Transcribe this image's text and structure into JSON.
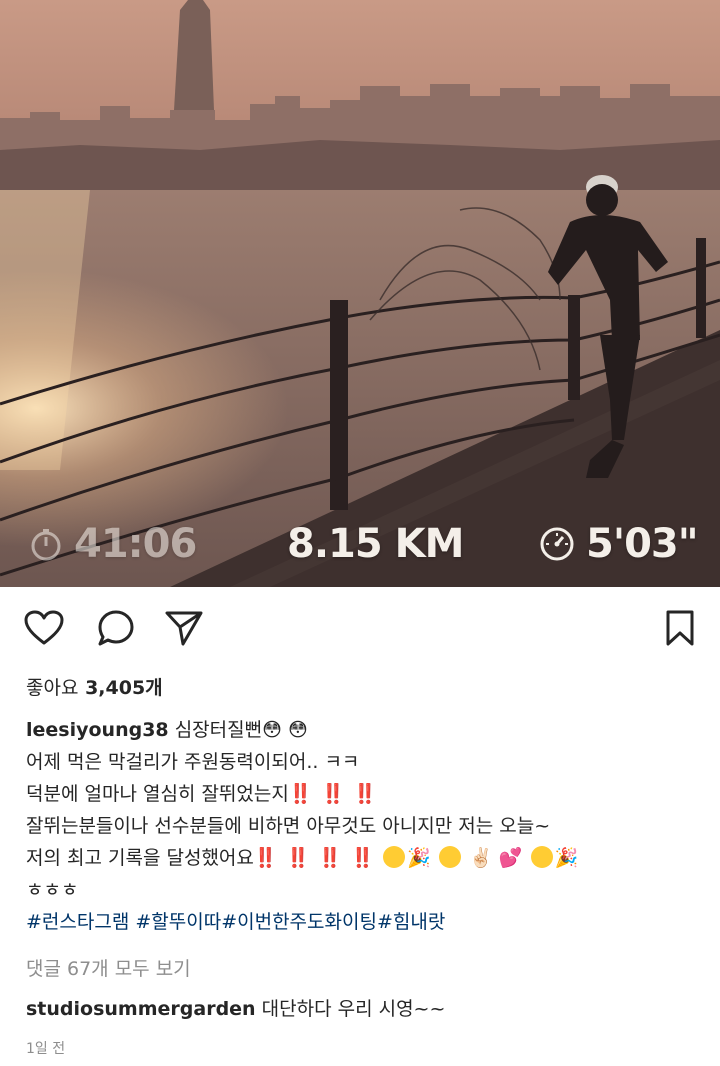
{
  "post": {
    "overlay_stats": {
      "time": "41:06",
      "distance": "8.15 KM",
      "pace": "5'03\"",
      "time_icon": "stopwatch-icon",
      "pace_icon": "speedometer-icon"
    },
    "actions": {
      "like_icon": "heart-icon",
      "comment_icon": "comment-icon",
      "share_icon": "send-icon",
      "save_icon": "bookmark-icon"
    },
    "likes": {
      "label": "좋아요",
      "count": "3,405개"
    },
    "caption": {
      "username": "leesiyoung38",
      "line1_text": "심장터질뻔",
      "line2": "어제 먹은 막걸리가 주원동력이되어.. ㅋㅋ",
      "line3_text": "덕분에 얼마나 열심히 잘뛰었는지",
      "line3_marks": "‼️ ‼️ ‼️",
      "line4": "잘뛰는분들이나 선수분들에 비하면 아무것도 아니지만 저는 오늘~",
      "line5_text": "저의 최고 기록을 달성했어요",
      "line5_marks": "‼️ ‼️ ‼️ ‼️",
      "line6": "ㅎㅎㅎ",
      "hashtags": "#런스타그램 #할뚜이따#이번한주도화이팅#힘내랏"
    },
    "view_comments": "댓글 67개 모두 보기",
    "comment": {
      "username": "studiosummergarden",
      "text": "대단하다 우리 시영~~"
    },
    "time_ago": "1일 전",
    "colors": {
      "link": "#003569",
      "muted": "#8e8e8e",
      "text": "#262626",
      "alert": "#e0182d"
    }
  }
}
